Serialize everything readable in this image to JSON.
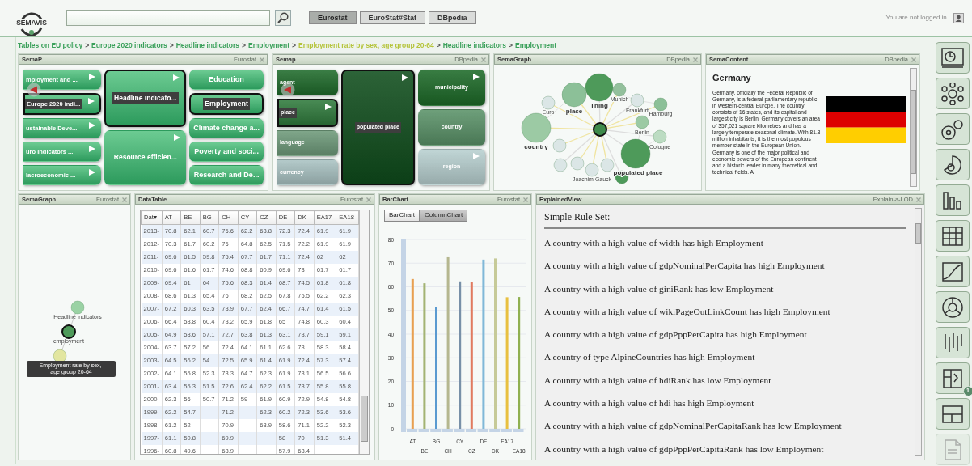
{
  "header": {
    "logo": "SEMAVIS",
    "sources": [
      {
        "label": "Eurostat",
        "selected": true
      },
      {
        "label": "EuroStat#Stat",
        "selected": false
      },
      {
        "label": "DBpedia",
        "selected": false
      }
    ],
    "login_status": "You are not logged in."
  },
  "breadcrumb": {
    "separator": ">",
    "items": [
      {
        "label": "Tables on EU policy",
        "selected": false
      },
      {
        "label": "Europe 2020 indicators",
        "selected": false
      },
      {
        "label": "Headline indicators",
        "selected": false
      },
      {
        "label": "Employment",
        "selected": false
      },
      {
        "label": "Employment rate by sex, age group 20-64",
        "selected": true
      },
      {
        "label": "Headline indicators",
        "selected": false
      },
      {
        "label": "Employment",
        "selected": false
      }
    ]
  },
  "top_panels": [
    {
      "kind": "treemap",
      "title": "SemaP",
      "source": "Eurostat",
      "columns": [
        [
          {
            "label": "mployment and ...",
            "selected": false,
            "expandable": true
          },
          {
            "label": "Europe 2020 indi...",
            "selected": true,
            "expandable": true
          },
          {
            "label": "ustainable Deve...",
            "selected": false,
            "expandable": true
          },
          {
            "label": "uro indicators ...",
            "selected": false,
            "expandable": true
          },
          {
            "label": "lacroeconomic ...",
            "selected": false,
            "expandable": true
          }
        ],
        [
          {
            "label": "Headline indicato...",
            "selected": true,
            "expandable": true
          },
          {
            "label": "Resource efficien...",
            "selected": false,
            "expandable": true
          }
        ],
        [
          {
            "label": "Education",
            "selected": false,
            "expandable": false
          },
          {
            "label": "Employment",
            "selected": true,
            "expandable": false
          },
          {
            "label": "Climate change a...",
            "selected": false,
            "expandable": false
          },
          {
            "label": "Poverty and soci...",
            "selected": false,
            "expandable": false
          },
          {
            "label": "Research and De...",
            "selected": false,
            "expandable": false
          }
        ]
      ]
    },
    {
      "kind": "treemap",
      "title": "Semap",
      "source": "DBpedia",
      "columns": [
        [
          {
            "label": "agent",
            "selected": false,
            "expandable": false,
            "color": "#1f6b2b"
          },
          {
            "label": "place",
            "selected": true,
            "expandable": true,
            "color": "#2f7a3c"
          },
          {
            "label": "language",
            "selected": false,
            "expandable": false,
            "color": "#6e9a7a"
          },
          {
            "label": "currency",
            "selected": false,
            "expandable": false,
            "color": "#a9c2c2"
          }
        ],
        [
          {
            "label": "populated place",
            "selected": true,
            "expandable": true,
            "color": "#0f4d1c"
          }
        ],
        [
          {
            "label": "municipality",
            "selected": false,
            "expandable": true,
            "color": "#1d6a28"
          },
          {
            "label": "country",
            "selected": false,
            "expandable": false,
            "color": "#5a9268"
          },
          {
            "label": "region",
            "selected": false,
            "expandable": true,
            "color": "#b8d0d0"
          }
        ]
      ]
    },
    {
      "kind": "graph",
      "title": "SemaGraph",
      "source": "DBpedia",
      "nodes": [
        {
          "label": "Thing",
          "kind": "class"
        },
        {
          "label": "place",
          "kind": "class"
        },
        {
          "label": "country",
          "kind": "class"
        },
        {
          "label": "populated place",
          "kind": "class"
        },
        {
          "label": "Euro",
          "kind": "instance"
        },
        {
          "label": "Munich",
          "kind": "instance"
        },
        {
          "label": "Frankfurt",
          "kind": "instance"
        },
        {
          "label": "Hamburg",
          "kind": "instance"
        },
        {
          "label": "Berlin",
          "kind": "instance"
        },
        {
          "label": "Cologne",
          "kind": "instance"
        },
        {
          "label": "Joachim Gauck",
          "kind": "instance"
        }
      ]
    },
    {
      "kind": "content",
      "title": "SemaContent",
      "source": "DBpedia",
      "heading": "Germany",
      "text": "Germany, officially the Federal Republic of Germany, is a federal parliamentary republic in western-central Europe. The country consists of 16 states, and its capital and largest city is Berlin. Germany covers an area of 357,021 square kilometres and has a largely temperate seasonal climate. With 81.8 million inhabitants, it is the most populous member state in the European Union. Germany is one of the major political and economic powers of the European continent and a historic leader in many theoretical and technical fields. A"
    }
  ],
  "bottom_panels": [
    {
      "kind": "mini_graph",
      "title": "SemaGraph",
      "source": "Eurostat",
      "nodes": [
        {
          "label": "Headline indicators",
          "selected": false,
          "highlighted": false
        },
        {
          "label": "employment",
          "selected": true,
          "highlighted": false
        },
        {
          "label": "Employment rate by sex, age group 20-64",
          "selected": false,
          "highlighted": true
        }
      ]
    },
    {
      "kind": "table",
      "title": "DataTable",
      "source": "Eurostat",
      "columns": [
        "Dat▾",
        "AT",
        "BE",
        "BG",
        "CH",
        "CY",
        "CZ",
        "DE",
        "DK",
        "EA17",
        "EA18"
      ],
      "rows": [
        [
          "2013-",
          "70.8",
          "62.1",
          "60.7",
          "76.6",
          "62.2",
          "63.8",
          "72.3",
          "72.4",
          "61.9",
          "61.9"
        ],
        [
          "2012-",
          "70.3",
          "61.7",
          "60.2",
          "76",
          "64.8",
          "62.5",
          "71.5",
          "72.2",
          "61.9",
          "61.9"
        ],
        [
          "2011-",
          "69.6",
          "61.5",
          "59.8",
          "75.4",
          "67.7",
          "61.7",
          "71.1",
          "72.4",
          "62",
          "62"
        ],
        [
          "2010-",
          "69.6",
          "61.6",
          "61.7",
          "74.6",
          "68.8",
          "60.9",
          "69.6",
          "73",
          "61.7",
          "61.7"
        ],
        [
          "2009-",
          "69.4",
          "61",
          "64",
          "75.6",
          "68.3",
          "61.4",
          "68.7",
          "74.5",
          "61.8",
          "61.8"
        ],
        [
          "2008-",
          "68.6",
          "61.3",
          "65.4",
          "76",
          "68.2",
          "62.5",
          "67.8",
          "75.5",
          "62.2",
          "62.3"
        ],
        [
          "2007-",
          "67.2",
          "60.3",
          "63.5",
          "73.9",
          "67.7",
          "62.4",
          "66.7",
          "74.7",
          "61.4",
          "61.5"
        ],
        [
          "2006-",
          "66.4",
          "58.8",
          "60.4",
          "73.2",
          "65.9",
          "61.8",
          "65",
          "74.8",
          "60.3",
          "60.4"
        ],
        [
          "2005-",
          "64.9",
          "58.6",
          "57.1",
          "72.7",
          "63.8",
          "61.3",
          "63.1",
          "73.7",
          "59.1",
          "59.1"
        ],
        [
          "2004-",
          "63.7",
          "57.2",
          "56",
          "72.4",
          "64.1",
          "61.1",
          "62.6",
          "73",
          "58.3",
          "58.4"
        ],
        [
          "2003-",
          "64.5",
          "56.2",
          "54",
          "72.5",
          "65.9",
          "61.4",
          "61.9",
          "72.4",
          "57.3",
          "57.4"
        ],
        [
          "2002-",
          "64.1",
          "55.8",
          "52.3",
          "73.3",
          "64.7",
          "62.3",
          "61.9",
          "73.1",
          "56.5",
          "56.6"
        ],
        [
          "2001-",
          "63.4",
          "55.3",
          "51.5",
          "72.6",
          "62.4",
          "62.2",
          "61.5",
          "73.7",
          "55.8",
          "55.8"
        ],
        [
          "2000-",
          "62.3",
          "56",
          "50.7",
          "71.2",
          "59",
          "61.9",
          "60.9",
          "72.9",
          "54.8",
          "54.8"
        ],
        [
          "1999-",
          "62.2",
          "54.7",
          null,
          "71.2",
          null,
          "62.3",
          "60.2",
          "72.3",
          "53.6",
          "53.6"
        ],
        [
          "1998-",
          "61.2",
          "52",
          null,
          "70.9",
          null,
          "63.9",
          "58.6",
          "71.1",
          "52.2",
          "52.3"
        ],
        [
          "1997-",
          "61.1",
          "50.8",
          null,
          "69.9",
          null,
          null,
          "58",
          "70",
          "51.3",
          "51.4"
        ],
        [
          "1996-",
          "60.8",
          "49.6",
          null,
          "68.9",
          null,
          null,
          "57.9",
          "68.4",
          null,
          null
        ]
      ]
    },
    {
      "kind": "chart",
      "title": "BarChart",
      "source": "Eurostat",
      "modes": [
        {
          "label": "BarChart",
          "selected": false
        },
        {
          "label": "ColumnChart",
          "selected": true
        }
      ],
      "chart_data": {
        "type": "bar",
        "categories": [
          "AT",
          "BE",
          "BG",
          "CH",
          "CY",
          "CZ",
          "DE",
          "DK",
          "EA17",
          "EA18"
        ],
        "ylim": [
          0,
          80
        ],
        "yticks": [
          0,
          10,
          20,
          30,
          40,
          50,
          60,
          70,
          80
        ],
        "grid": true,
        "values": [
          63.3,
          61.5,
          51.5,
          72.5,
          62.3,
          62,
          71.5,
          72,
          55.6,
          55.7
        ],
        "colors": [
          "#e8a050",
          "#a3b373",
          "#5a9ad0",
          "#b5b78f",
          "#7890a8",
          "#e07a60",
          "#80b8d8",
          "#c6ca98",
          "#e8c040",
          "#8fb050"
        ]
      }
    },
    {
      "kind": "rules",
      "title": "ExplainedView",
      "source": "Explain-a-LOD",
      "heading": "Simple Rule Set:",
      "rules": [
        "A country with a high value of width has high Employment",
        "A country with a high value of gdpNominalPerCapita has high Employment",
        "A country with a high value of giniRank has low Employment",
        "A country with a high value of wikiPageOutLinkCount has high Employment",
        "A country with a high value of gdpPppPerCapita has high Employment",
        "A country of type AlpineCountries has high Employment",
        "A country with a high value of hdiRank has low Employment",
        "A country with a high value of hdi has high Employment",
        "A country with a high value of gdpNominalPerCapitaRank has low Employment",
        "A country with a high value of gdpPppPerCapitaRank has low Employment"
      ]
    }
  ],
  "sidebar": [
    {
      "kind": "map",
      "disabled": false
    },
    {
      "kind": "network",
      "disabled": false
    },
    {
      "kind": "circles",
      "disabled": false
    },
    {
      "kind": "pie",
      "disabled": false
    },
    {
      "kind": "bars",
      "disabled": false
    },
    {
      "kind": "grid",
      "disabled": false
    },
    {
      "kind": "line",
      "disabled": false
    },
    {
      "kind": "donut",
      "disabled": false
    },
    {
      "kind": "parallel",
      "disabled": false
    },
    {
      "kind": "treemap",
      "disabled": false,
      "badge": "1"
    },
    {
      "kind": "layout",
      "disabled": false
    },
    {
      "kind": "document",
      "disabled": true
    }
  ]
}
